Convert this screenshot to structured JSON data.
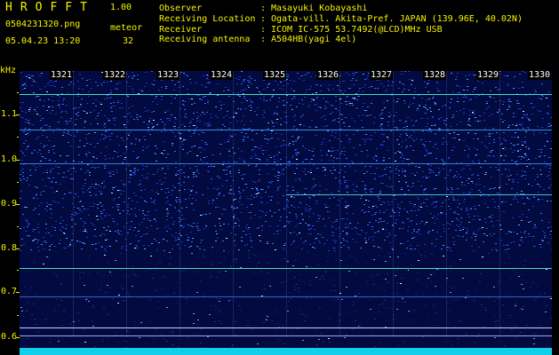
{
  "header": {
    "app_name": "HROFFT",
    "version": "1.00",
    "filename": "0504231320.png",
    "datetime": "05.04.23 13:20",
    "meteor_label": "meteor",
    "meteor_count": "32"
  },
  "info": [
    {
      "label": "Observer",
      "value": "Masayuki Kobayashi"
    },
    {
      "label": "Receiving Location",
      "value": "Ogata-vill. Akita-Pref. JAPAN (139.96E, 40.02N)"
    },
    {
      "label": "Receiver",
      "value": "ICOM IC-575 53.7492(@LCD)MHz USB"
    },
    {
      "label": "Receiving antenna",
      "value": "A504HB(yagi 4el)"
    }
  ],
  "separator": ":",
  "axis": {
    "y_unit": "kHz",
    "y_ticks": [
      "1.1",
      "1.0",
      "0.9",
      "0.8",
      "0.7",
      "0.6"
    ],
    "x_ticks": [
      "1321",
      "1322",
      "1323",
      "1324",
      "1325",
      "1326",
      "1327",
      "1328",
      "1329",
      "1330"
    ]
  },
  "colors": {
    "text": "#f4f400",
    "background": "#000000",
    "noise_floor": "#030a40",
    "carrier": "#40e0c0",
    "band": "#10cfe8"
  }
}
